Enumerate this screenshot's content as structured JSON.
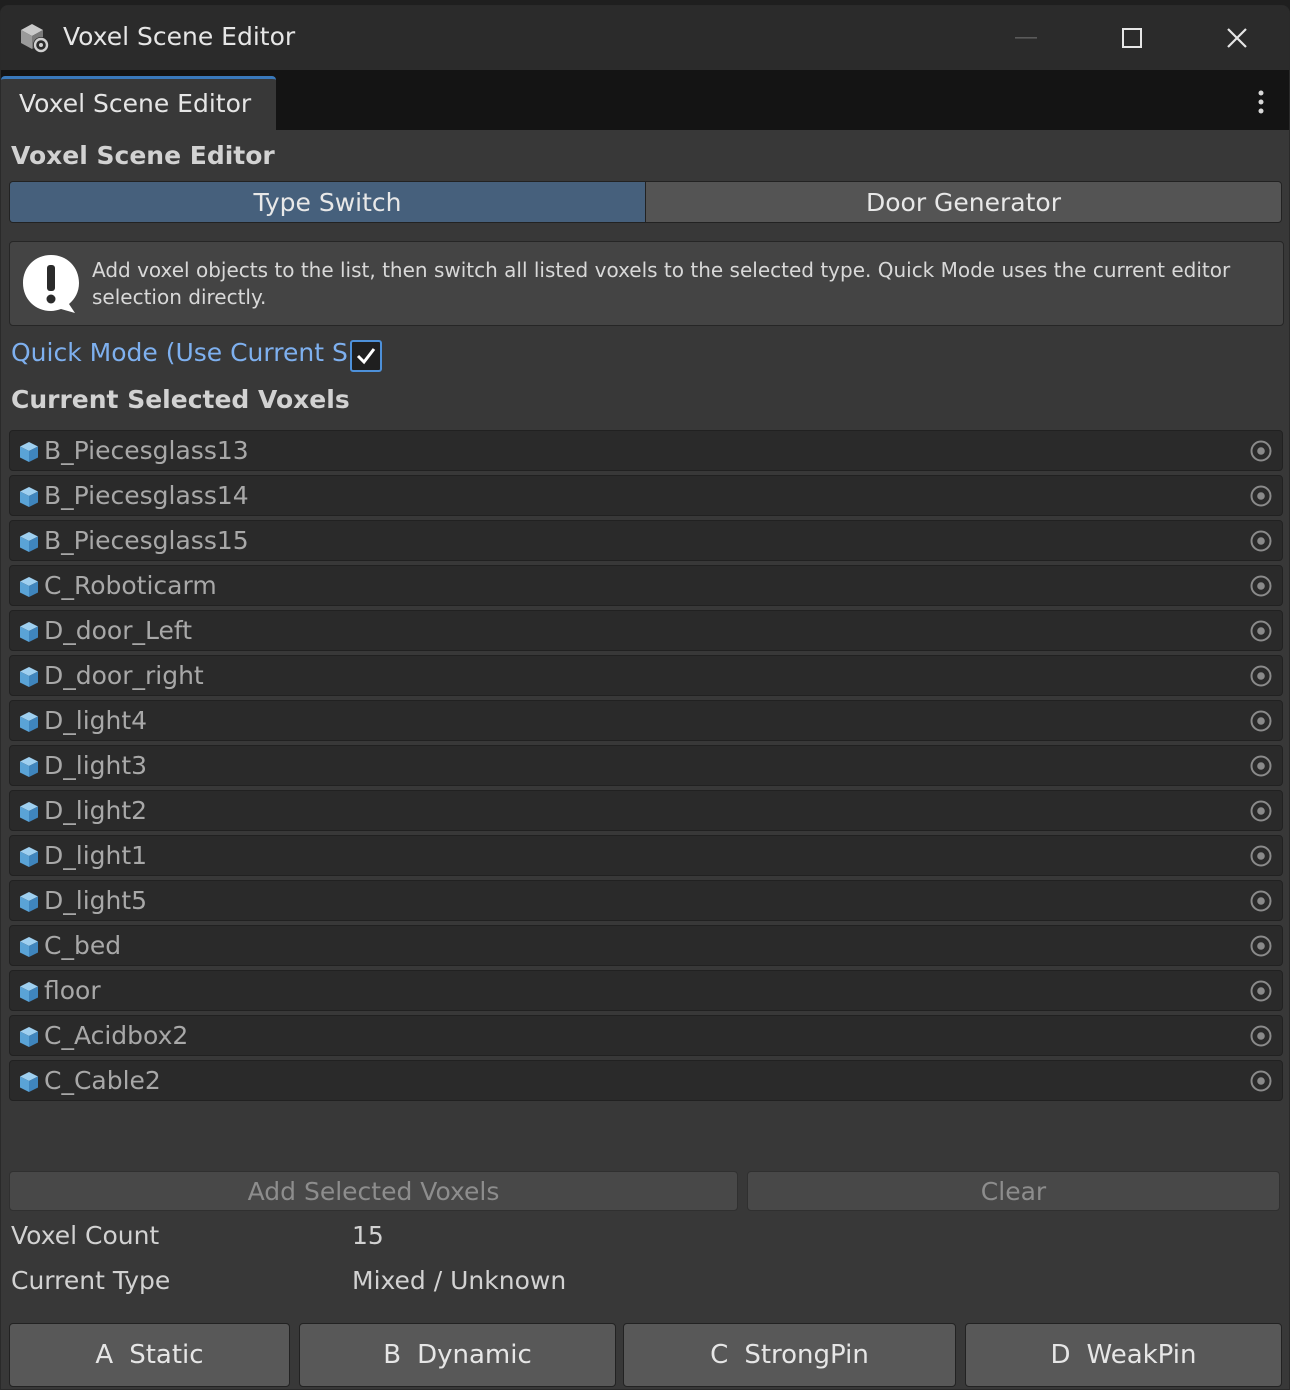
{
  "window": {
    "title": "Voxel Scene Editor"
  },
  "tabs": [
    {
      "label": "Voxel Scene Editor",
      "active": true
    }
  ],
  "panel": {
    "title": "Voxel Scene Editor",
    "modes": [
      {
        "label": "Type Switch",
        "active": true
      },
      {
        "label": "Door Generator",
        "active": false
      }
    ],
    "help_text": "Add voxel objects to the list, then switch all listed voxels to the selected type. Quick Mode uses the current editor selection directly.",
    "quick_mode": {
      "label": "Quick Mode (Use Current Selection)",
      "checked": true
    },
    "list_title": "Current Selected Voxels",
    "voxels": [
      {
        "name": "B_Piecesglass13"
      },
      {
        "name": "B_Piecesglass14"
      },
      {
        "name": "B_Piecesglass15"
      },
      {
        "name": "C_Roboticarm"
      },
      {
        "name": "D_door_Left"
      },
      {
        "name": "D_door_right"
      },
      {
        "name": "D_light4"
      },
      {
        "name": "D_light3"
      },
      {
        "name": "D_light2"
      },
      {
        "name": "D_light1"
      },
      {
        "name": "D_light5"
      },
      {
        "name": "C_bed"
      },
      {
        "name": "floor"
      },
      {
        "name": "C_Acidbox2"
      },
      {
        "name": "C_Cable2"
      }
    ],
    "add_button": "Add Selected Voxels",
    "clear_button": "Clear",
    "voxel_count_label": "Voxel Count",
    "voxel_count_value": "15",
    "current_type_label": "Current Type",
    "current_type_value": "Mixed / Unknown",
    "type_buttons": [
      {
        "key": "A",
        "label": "Static"
      },
      {
        "key": "B",
        "label": "Dynamic"
      },
      {
        "key": "C",
        "label": "StrongPin"
      },
      {
        "key": "D",
        "label": "WeakPin"
      }
    ]
  },
  "colors": {
    "window_bg": "#383838",
    "active_mode": "#46607c",
    "accent_blue": "#4d90d9",
    "link_text": "#7eb0ef"
  },
  "icons": {
    "app": "unity-cube-gear-icon",
    "row": "cube-icon",
    "row_action": "object-picker-icon",
    "help": "warning-speech-bubble-icon"
  }
}
